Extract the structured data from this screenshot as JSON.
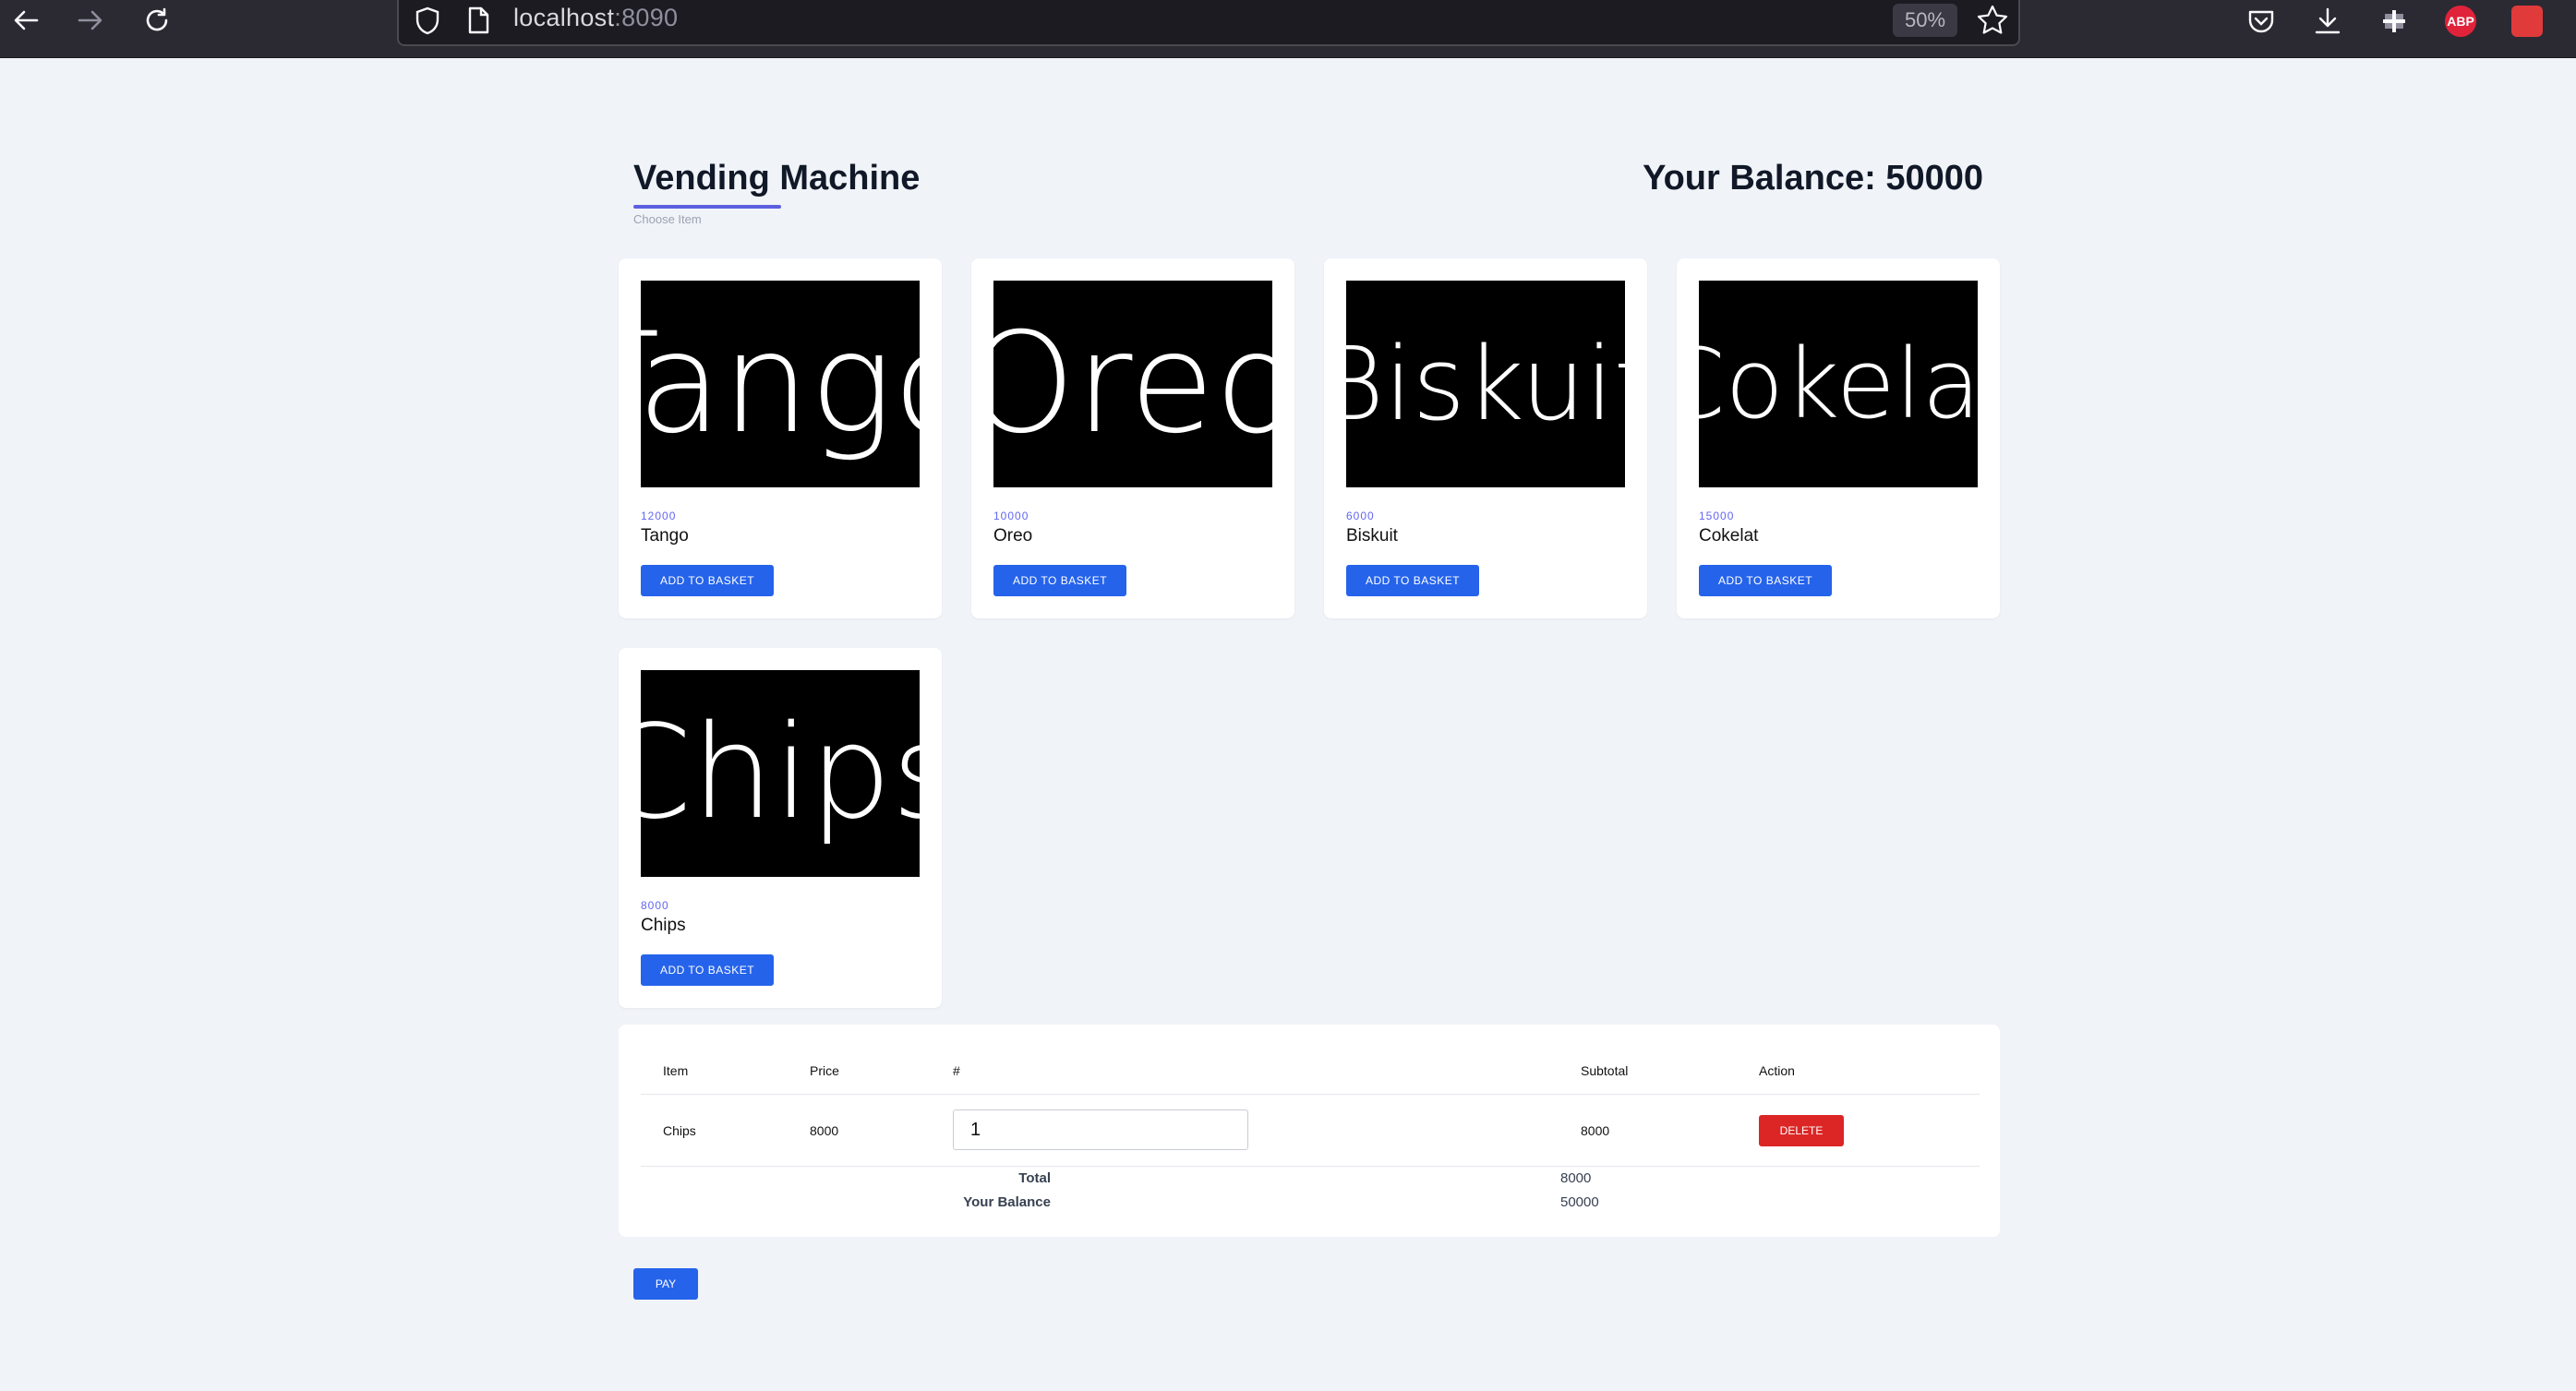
{
  "browser": {
    "url_host": "localhost",
    "url_port": ":8090",
    "zoom": "50%",
    "abp_label": "ABP"
  },
  "header": {
    "title": "Vending Machine",
    "subtitle": "Choose Item",
    "balance": "Your Balance: 50000"
  },
  "products": [
    {
      "name": "Tango",
      "price": "12000",
      "image_text": "Tango",
      "button": "ADD TO BASKET"
    },
    {
      "name": "Oreo",
      "price": "10000",
      "image_text": "Oreo",
      "button": "ADD TO BASKET"
    },
    {
      "name": "Biskuit",
      "price": "6000",
      "image_text": "Biskuit",
      "button": "ADD TO BASKET"
    },
    {
      "name": "Cokelat",
      "price": "15000",
      "image_text": "Cokelat",
      "button": "ADD TO BASKET"
    },
    {
      "name": "Chips",
      "price": "8000",
      "image_text": "Chips",
      "button": "ADD TO BASKET"
    }
  ],
  "basket": {
    "headers": {
      "item": "Item",
      "price": "Price",
      "qty": "#",
      "subtotal": "Subtotal",
      "action": "Action"
    },
    "rows": [
      {
        "item": "Chips",
        "price": "8000",
        "qty": "1",
        "subtotal": "8000",
        "action": "DELETE"
      }
    ],
    "total_label": "Total",
    "total_value": "8000",
    "balance_label": "Your Balance",
    "balance_value": "50000"
  },
  "pay_button": "PAY"
}
